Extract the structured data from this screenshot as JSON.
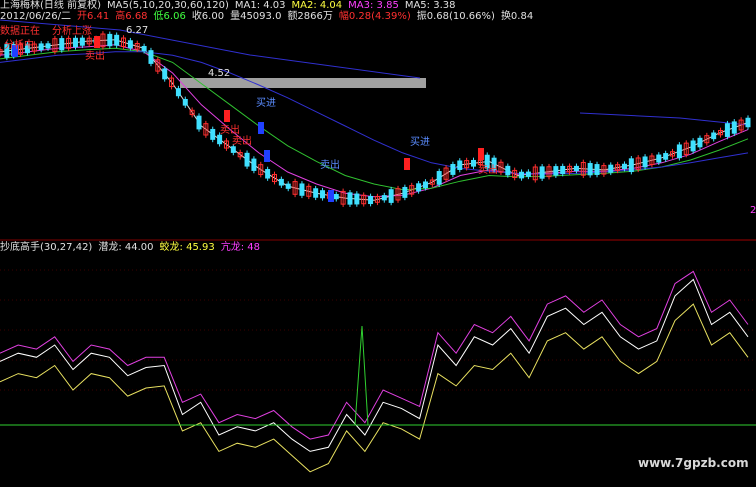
{
  "header": {
    "line1": {
      "instrument": "上海梅林(日线 前复权)",
      "ma_label": "MA5(5,10,20,30,60,120)",
      "ma1": "MA1: 4.03",
      "ma2": "MA2: 4.04",
      "ma3": "MA3: 3.85",
      "ma5": "MA5: 3.38"
    },
    "line2": {
      "date": "2012/06/26/二",
      "open": "开6.41",
      "high": "高6.68",
      "low": "低6.06",
      "close": "收6.00",
      "volume": "量45093.0",
      "amount": "额2866万",
      "change": "幅0.28(4.39%)",
      "amplitude": "振0.68(10.66%)",
      "turnover": "换0.84"
    }
  },
  "annotations": {
    "tags_left": [
      "数据正在",
      "分析上涨",
      "分析中"
    ],
    "buy_sell": [
      "卖出",
      "卖出",
      "卖出",
      "买进",
      "卖出",
      "买进",
      "卖出"
    ],
    "price_marks": [
      "6.27",
      "4.52"
    ],
    "right_edge": "2"
  },
  "indicator": {
    "name": "抄底高手(30,27,42)",
    "line1_label": "潜龙: 44.00",
    "line2_label": "蛟龙: 45.93",
    "line3_label": "亢龙: 48"
  },
  "watermark": "www.7gpzb.com",
  "colors": {
    "bg": "#000000",
    "up": "#ff3030",
    "down": "#40e0ff",
    "ma_white": "#d8d8d8",
    "ma_magenta": "#e040e0",
    "ma_green": "#30c030",
    "ma_blue": "#3030d0",
    "ind1": "#ffffff",
    "ind2": "#e8e060",
    "ind3": "#e040e0",
    "zero": "#30d030",
    "spike": "#30d030"
  },
  "chart_data": [
    {
      "type": "line",
      "title": "",
      "series": [
        {
          "name": "MA1",
          "values": [
            6.05,
            6.1,
            6.15,
            6.2,
            6.22,
            6.1,
            5.6,
            5.0,
            4.7,
            4.4,
            4.15,
            4.05,
            3.98,
            3.95,
            4.05,
            4.2,
            4.45,
            4.5,
            4.3,
            4.35,
            4.4,
            4.38,
            4.45,
            4.55,
            4.7,
            4.9,
            5.05
          ]
        },
        {
          "name": "MA2",
          "values": [
            6.0,
            6.05,
            6.1,
            6.12,
            6.15,
            6.05,
            5.75,
            5.3,
            4.95,
            4.62,
            4.35,
            4.18,
            4.05,
            4.0,
            4.02,
            4.12,
            4.3,
            4.38,
            4.32,
            4.33,
            4.36,
            4.36,
            4.4,
            4.48,
            4.6,
            4.78,
            4.95
          ]
        },
        {
          "name": "MA3",
          "values": [
            5.95,
            6.0,
            6.05,
            6.08,
            6.1,
            6.05,
            5.9,
            5.6,
            5.3,
            5.0,
            4.72,
            4.5,
            4.3,
            4.18,
            4.1,
            4.12,
            4.22,
            4.3,
            4.28,
            4.29,
            4.31,
            4.33,
            4.36,
            4.42,
            4.52,
            4.66,
            4.82
          ]
        },
        {
          "name": "MA5",
          "values": [
            5.9,
            5.95,
            6.0,
            6.02,
            6.05,
            6.05,
            6.0,
            5.9,
            5.75,
            5.58,
            5.4,
            5.2,
            5.0,
            4.8,
            4.62,
            4.48,
            4.4,
            4.36,
            4.33,
            4.32,
            4.33,
            4.35,
            4.38,
            4.42,
            4.48,
            4.55,
            4.62
          ]
        }
      ]
    },
    {
      "type": "line",
      "title": "",
      "series": [
        {
          "name": "潜龙",
          "values": [
            48,
            52,
            50,
            56,
            44,
            52,
            50,
            41,
            45,
            46,
            22,
            28,
            12,
            16,
            14,
            18,
            10,
            4,
            6,
            22,
            12,
            28,
            25,
            20,
            56,
            46,
            60,
            56,
            64,
            52,
            70,
            74,
            66,
            72,
            60,
            54,
            58,
            80,
            88,
            66,
            72,
            60
          ]
        },
        {
          "name": "蛟龙",
          "values": [
            38,
            42,
            40,
            46,
            34,
            42,
            40,
            31,
            35,
            36,
            14,
            18,
            4,
            8,
            6,
            10,
            2,
            -6,
            -2,
            14,
            4,
            18,
            15,
            10,
            42,
            36,
            46,
            44,
            52,
            40,
            58,
            62,
            54,
            60,
            48,
            42,
            48,
            68,
            76,
            56,
            62,
            50
          ]
        },
        {
          "name": "亢龙",
          "values": [
            52,
            56,
            54,
            60,
            48,
            56,
            54,
            46,
            50,
            50,
            28,
            32,
            18,
            22,
            20,
            24,
            16,
            10,
            12,
            28,
            18,
            34,
            30,
            26,
            62,
            52,
            66,
            62,
            70,
            58,
            76,
            80,
            72,
            78,
            66,
            60,
            64,
            86,
            92,
            72,
            78,
            66
          ]
        }
      ]
    }
  ]
}
